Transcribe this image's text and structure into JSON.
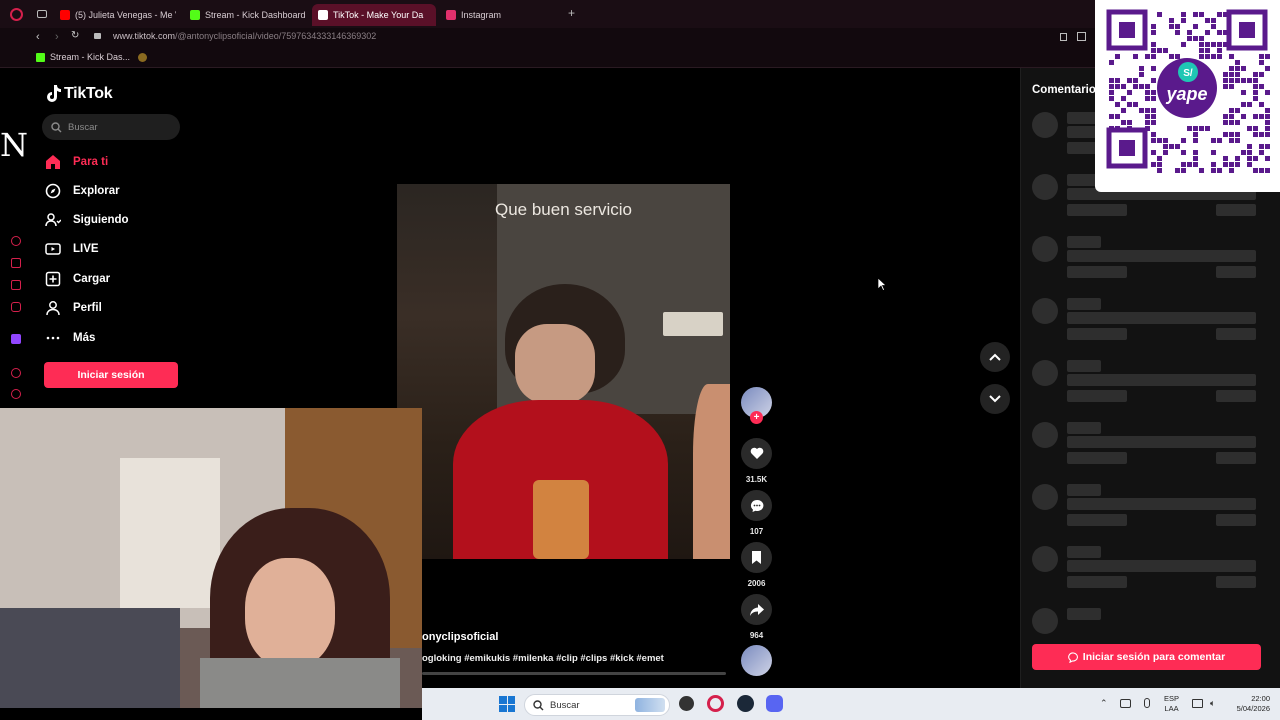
{
  "browser": {
    "tabs": [
      {
        "label": "(5) Julieta Venegas - Me V",
        "icon_color": "#ff0000"
      },
      {
        "label": "Stream - Kick Dashboard",
        "icon_color": "#53fc18"
      },
      {
        "label": "TikTok - Make Your Da",
        "icon_color": "#ffffff",
        "active": true
      },
      {
        "label": "Instagram",
        "icon_color": "#e1306c"
      }
    ],
    "url_host": "www.tiktok.com",
    "url_path": "/@antonyclipsoficial/video/7597634333146369302",
    "bookmarks": [
      {
        "label": "Stream - Kick Das..."
      }
    ]
  },
  "tiktok": {
    "logo": "TikTok",
    "search_placeholder": "Buscar",
    "nav": [
      {
        "label": "Para ti",
        "icon": "home-icon",
        "active": true
      },
      {
        "label": "Explorar",
        "icon": "compass-icon"
      },
      {
        "label": "Siguiendo",
        "icon": "users-icon"
      },
      {
        "label": "LIVE",
        "icon": "live-icon"
      },
      {
        "label": "Cargar",
        "icon": "upload-icon"
      },
      {
        "label": "Perfil",
        "icon": "user-icon"
      },
      {
        "label": "Más",
        "icon": "more-icon"
      }
    ],
    "login_button": "Iniciar sesión"
  },
  "video": {
    "subtitle": "Que buen servicio",
    "author": "onyclipsoficial",
    "caption": "ogloking #emikukis #milenka #clip #clips #kick #emet",
    "likes": "31.5K",
    "comments": "107",
    "saves": "2006",
    "shares": "964"
  },
  "comments_panel": {
    "title": "Comentario",
    "login_button": "Iniciar sesión para comentar"
  },
  "overlay": {
    "letter": "N",
    "qr_label": "yape",
    "qr_badge": "S/"
  },
  "taskbar": {
    "search_placeholder": "Buscar",
    "lang_top": "ESP",
    "lang_bottom": "LAA",
    "time": "22:00",
    "date": "5/04/2026"
  },
  "colors": {
    "accent": "#fe2c55",
    "opera": "#d5204c"
  }
}
